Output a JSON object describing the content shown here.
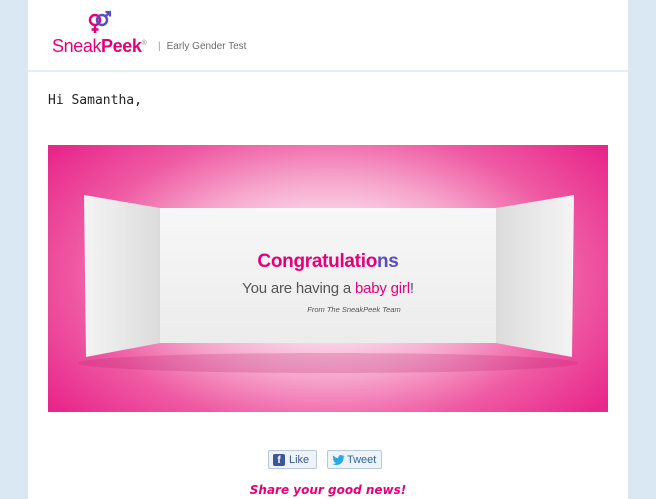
{
  "header": {
    "brand_light": "Sneak",
    "brand_bold": "Peek",
    "trademark": "®",
    "tagline": "Early Gender Test",
    "separator": "|"
  },
  "greeting": "Hi Samantha,",
  "banner": {
    "headline_main": "Congratulatio",
    "headline_tail": "ns",
    "line_prefix": "You are having a ",
    "line_highlight": "baby girl",
    "line_suffix": "!",
    "signature": "From The SneakPeek Team"
  },
  "social": {
    "like_label": "Like",
    "tweet_label": "Tweet",
    "like_icon": "facebook-icon",
    "tweet_icon": "twitter-bird-icon",
    "share_text": "Share your good news!"
  },
  "colors": {
    "brand_pink": "#e5007b",
    "accent_purple": "#5b4cc0",
    "page_background": "#d9e8f3",
    "facebook_blue": "#3b5998",
    "twitter_blue": "#2aa9e0"
  }
}
